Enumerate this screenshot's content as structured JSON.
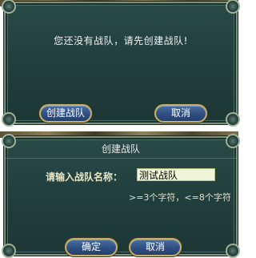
{
  "no_team_dialog": {
    "message": "您还没有战队，请先创建战队!",
    "create_button": "创建战队",
    "cancel_button": "取消"
  },
  "create_team_dialog": {
    "title": "创建战队",
    "name_label": "请输入战队名称：",
    "name_value": "测试战队",
    "hint": ">=3个字符，<=8个字符",
    "confirm_button": "确定",
    "cancel_button": "取消"
  }
}
